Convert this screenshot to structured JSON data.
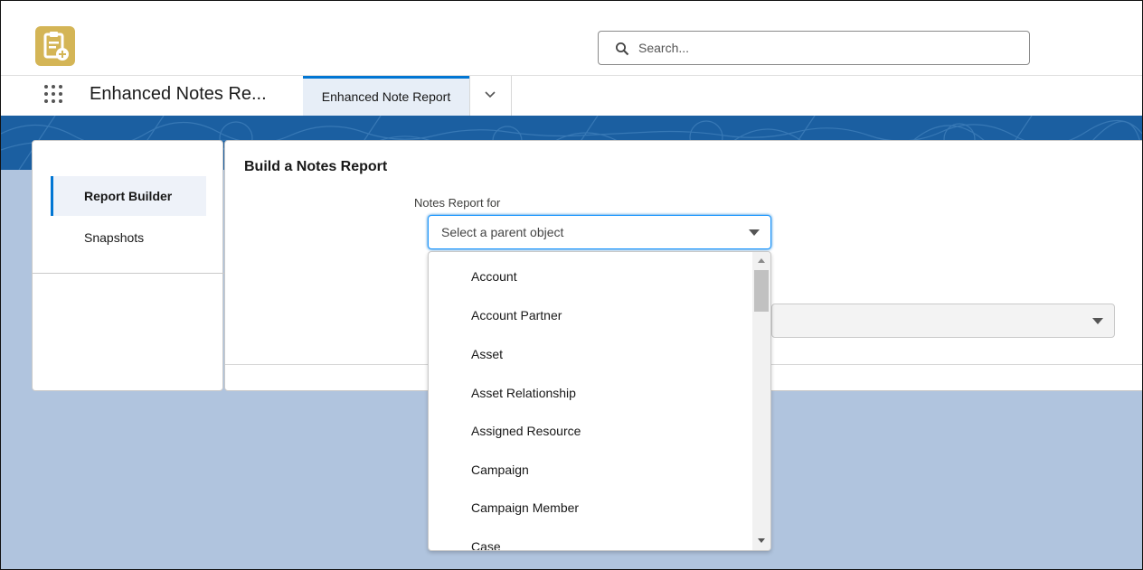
{
  "header": {
    "logo_icon": "notes-report-icon",
    "search_placeholder": "Search..."
  },
  "nav": {
    "app_name": "Enhanced Notes Re...",
    "tab_label": "Enhanced Note Report",
    "tab_menu_icon": "chevron-down-icon"
  },
  "sidebar": {
    "items": [
      {
        "label": "Report Builder",
        "active": true
      },
      {
        "label": "Snapshots",
        "active": false
      }
    ]
  },
  "main": {
    "title": "Build a Notes Report",
    "field_label": "Notes Report for",
    "combobox_placeholder": "Select a parent object",
    "dropdown_options": [
      "Account",
      "Account Partner",
      "Asset",
      "Asset Relationship",
      "Assigned Resource",
      "Campaign",
      "Campaign Member",
      "Case"
    ]
  },
  "colors": {
    "brand_blue": "#0176d3",
    "banner": "#1b5fa1",
    "backdrop": "#b0c4de",
    "logo_gold": "#d4b556"
  }
}
